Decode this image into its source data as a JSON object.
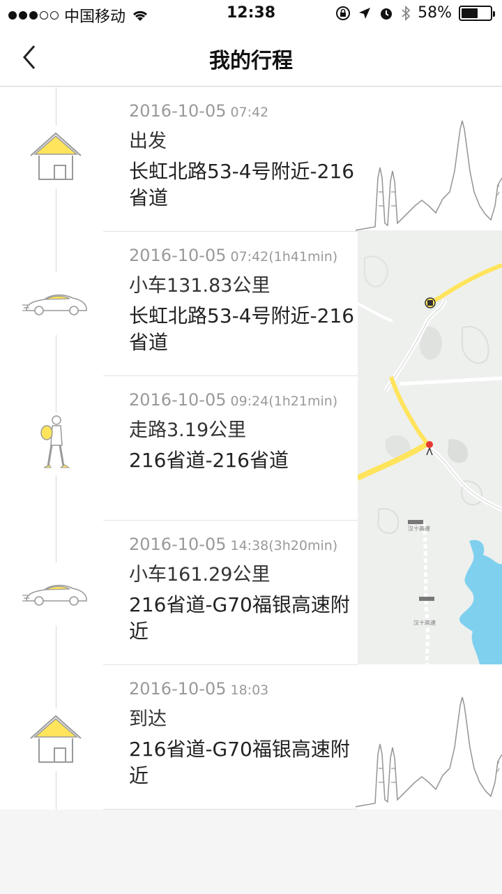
{
  "status_bar": {
    "carrier": "中国移动",
    "time": "12:38",
    "battery_percent": "58%",
    "battery_level": 0.58
  },
  "nav": {
    "title": "我的行程"
  },
  "trips": [
    {
      "date": "2016-10-05",
      "time": "07:42",
      "mode": "出发",
      "place": "长虹北路53-4号附近-216省道",
      "icon": "house-icon"
    },
    {
      "date": "2016-10-05",
      "time": "07:42(1h41min)",
      "mode": "小车131.83公里",
      "place": "长虹北路53-4号附近-216省道",
      "icon": "car-icon"
    },
    {
      "date": "2016-10-05",
      "time": "09:24(1h21min)",
      "mode": "走路3.19公里",
      "place": "216省道-216省道",
      "icon": "walker-icon"
    },
    {
      "date": "2016-10-05",
      "time": "14:38(3h20min)",
      "mode": "小车161.29公里",
      "place": "216省道-G70福银高速附近",
      "icon": "car-icon"
    },
    {
      "date": "2016-10-05",
      "time": "18:03",
      "mode": "到达",
      "place": "216省道-G70福银高速附近",
      "icon": "house-icon"
    }
  ],
  "map": {
    "labels": [
      "汉十高速",
      "汉十高速"
    ]
  },
  "colors": {
    "accent": "#FFE45C",
    "line": "#d8d8d8",
    "water": "#7fd0ee"
  }
}
